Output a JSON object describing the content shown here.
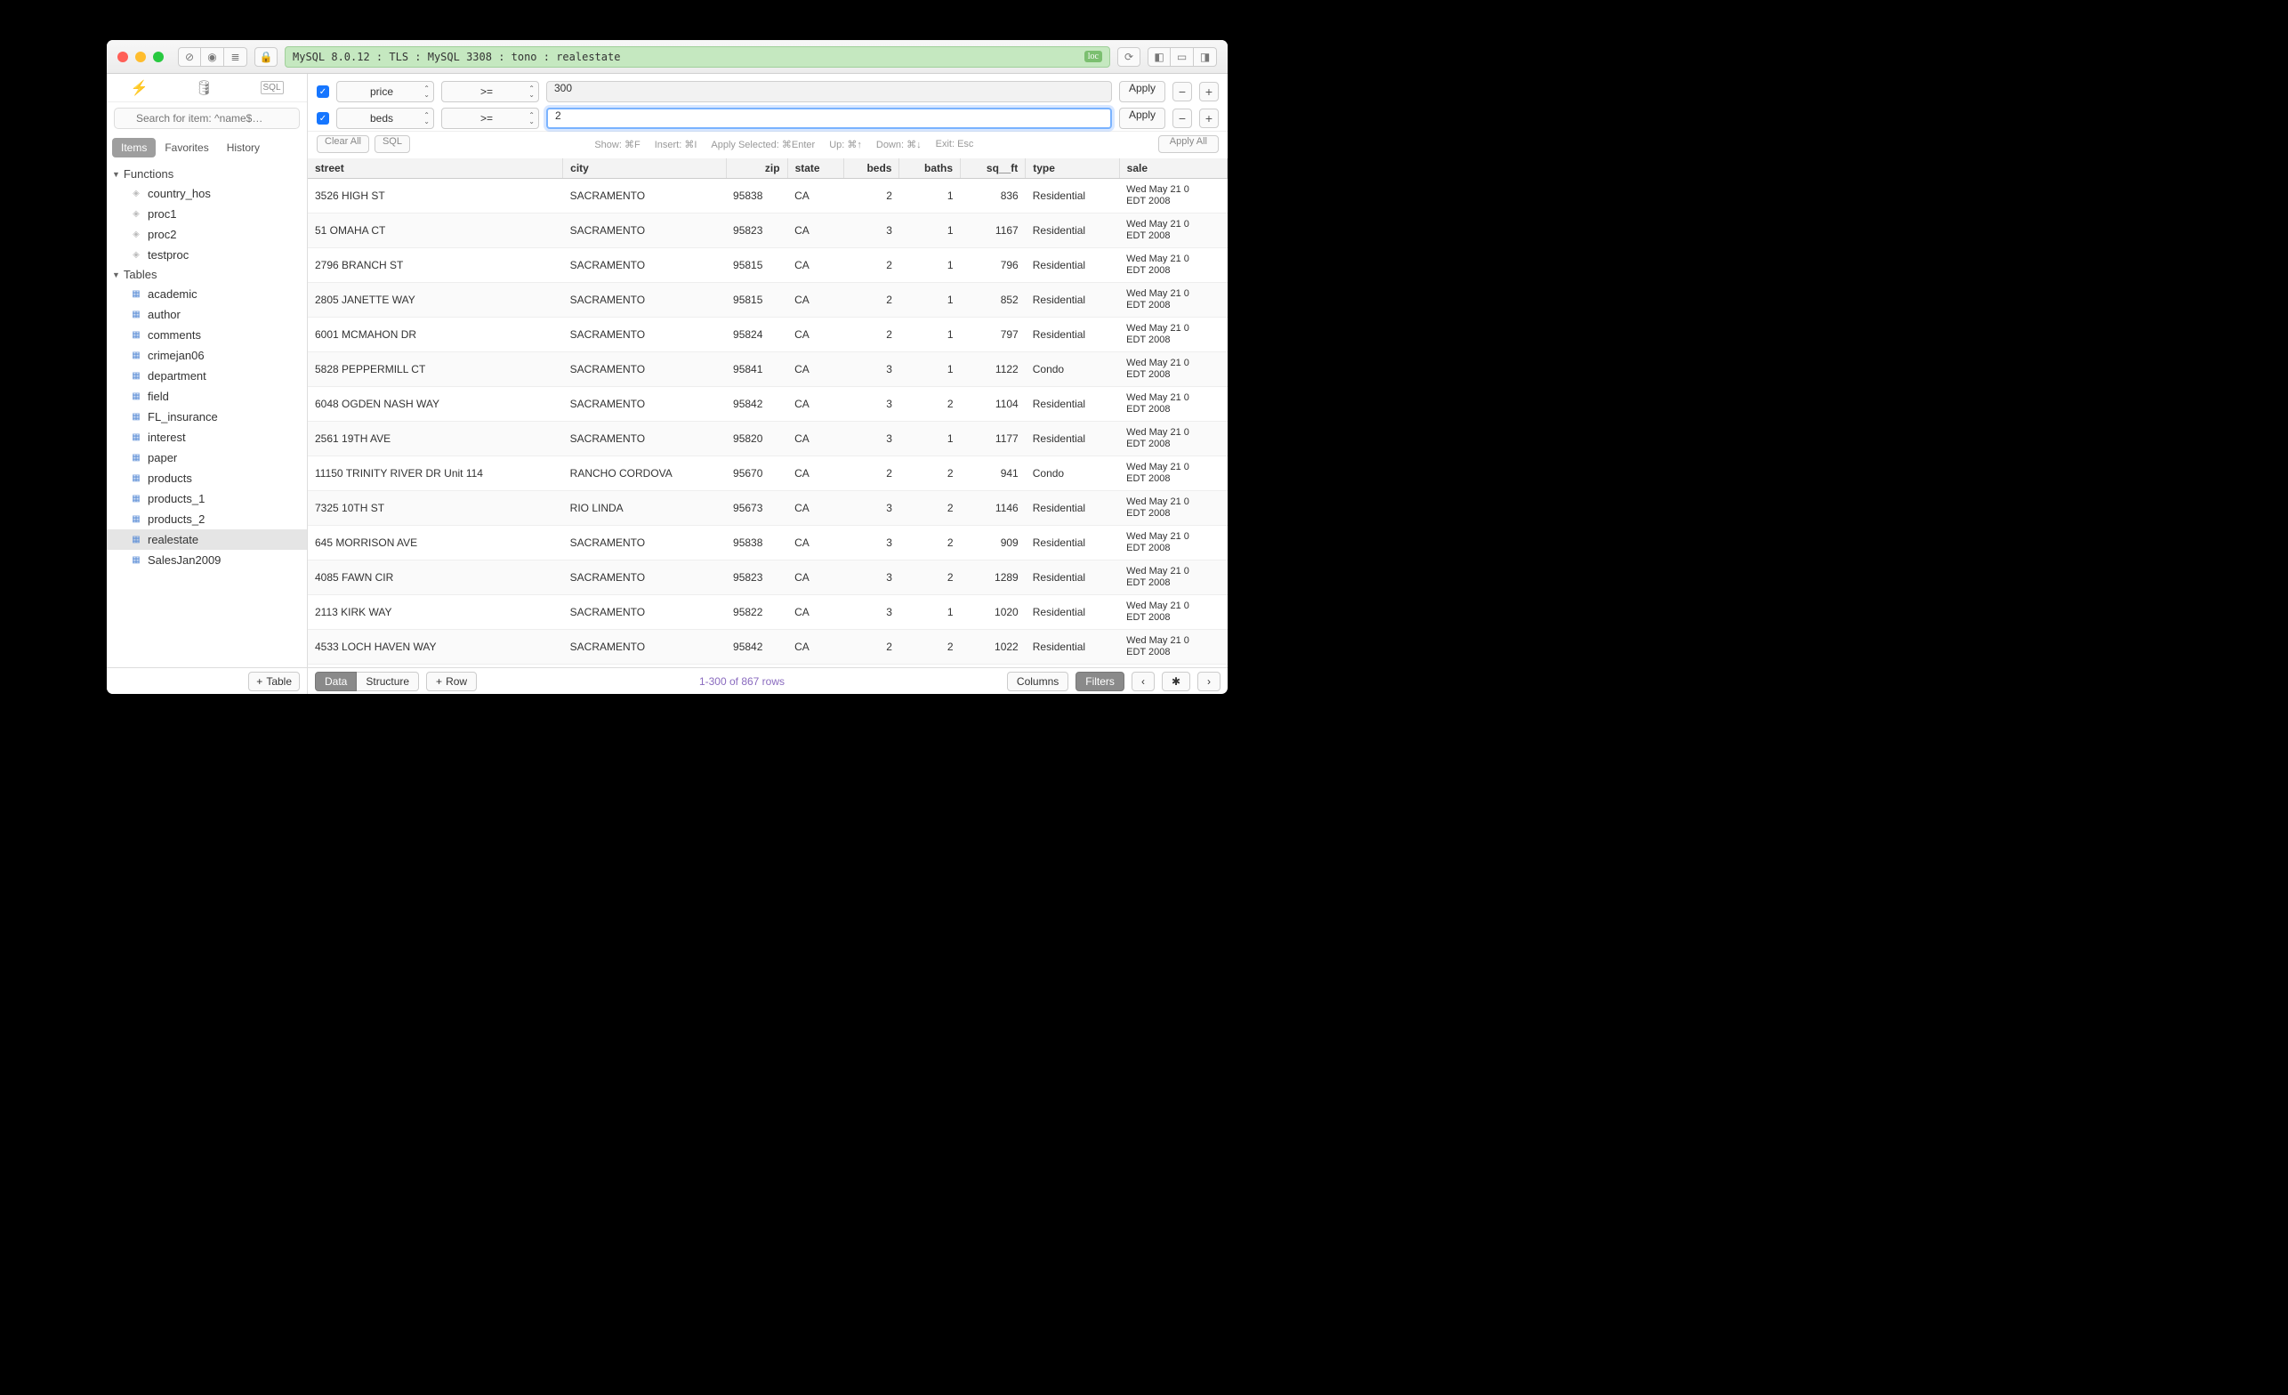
{
  "connection": "MySQL 8.0.12  :  TLS  :  MySQL 3308  :  tono  :  realestate",
  "loc_badge": "loc",
  "sidebar": {
    "search_placeholder": "Search for item: ^name$…",
    "segs": [
      "Items",
      "Favorites",
      "History"
    ],
    "functions_label": "Functions",
    "functions": [
      "country_hos",
      "proc1",
      "proc2",
      "testproc"
    ],
    "tables_label": "Tables",
    "tables": [
      "academic",
      "author",
      "comments",
      "crimejan06",
      "department",
      "field",
      "FL_insurance",
      "interest",
      "paper",
      "products",
      "products_1",
      "products_2",
      "realestate",
      "SalesJan2009"
    ],
    "selected_table": "realestate",
    "add_table": "Table"
  },
  "filters": [
    {
      "enabled": true,
      "column": "price",
      "op": ">=",
      "value": "300",
      "active": false
    },
    {
      "enabled": true,
      "column": "beds",
      "op": ">=",
      "value": "2",
      "active": true
    }
  ],
  "filter_buttons": {
    "apply": "Apply",
    "clear_all": "Clear All",
    "sql": "SQL",
    "apply_all": "Apply All"
  },
  "hints": {
    "show": "Show: ⌘F",
    "insert": "Insert: ⌘I",
    "apply_sel": "Apply Selected: ⌘Enter",
    "up": "Up: ⌘↑",
    "down": "Down: ⌘↓",
    "exit": "Exit: Esc"
  },
  "columns": [
    "street",
    "city",
    "zip",
    "state",
    "beds",
    "baths",
    "sq__ft",
    "type",
    "sale"
  ],
  "rows": [
    {
      "street": "3526 HIGH ST",
      "city": "SACRAMENTO",
      "zip": "95838",
      "state": "CA",
      "beds": 2,
      "baths": 1,
      "sqft": 836,
      "type": "Residential",
      "sale": "Wed May 21 0\nEDT 2008"
    },
    {
      "street": "51 OMAHA CT",
      "city": "SACRAMENTO",
      "zip": "95823",
      "state": "CA",
      "beds": 3,
      "baths": 1,
      "sqft": 1167,
      "type": "Residential",
      "sale": "Wed May 21 0\nEDT 2008"
    },
    {
      "street": "2796 BRANCH ST",
      "city": "SACRAMENTO",
      "zip": "95815",
      "state": "CA",
      "beds": 2,
      "baths": 1,
      "sqft": 796,
      "type": "Residential",
      "sale": "Wed May 21 0\nEDT 2008"
    },
    {
      "street": "2805 JANETTE WAY",
      "city": "SACRAMENTO",
      "zip": "95815",
      "state": "CA",
      "beds": 2,
      "baths": 1,
      "sqft": 852,
      "type": "Residential",
      "sale": "Wed May 21 0\nEDT 2008"
    },
    {
      "street": "6001 MCMAHON DR",
      "city": "SACRAMENTO",
      "zip": "95824",
      "state": "CA",
      "beds": 2,
      "baths": 1,
      "sqft": 797,
      "type": "Residential",
      "sale": "Wed May 21 0\nEDT 2008"
    },
    {
      "street": "5828 PEPPERMILL CT",
      "city": "SACRAMENTO",
      "zip": "95841",
      "state": "CA",
      "beds": 3,
      "baths": 1,
      "sqft": 1122,
      "type": "Condo",
      "sale": "Wed May 21 0\nEDT 2008"
    },
    {
      "street": "6048 OGDEN NASH WAY",
      "city": "SACRAMENTO",
      "zip": "95842",
      "state": "CA",
      "beds": 3,
      "baths": 2,
      "sqft": 1104,
      "type": "Residential",
      "sale": "Wed May 21 0\nEDT 2008"
    },
    {
      "street": "2561 19TH AVE",
      "city": "SACRAMENTO",
      "zip": "95820",
      "state": "CA",
      "beds": 3,
      "baths": 1,
      "sqft": 1177,
      "type": "Residential",
      "sale": "Wed May 21 0\nEDT 2008"
    },
    {
      "street": "11150 TRINITY RIVER DR Unit 114",
      "city": "RANCHO CORDOVA",
      "zip": "95670",
      "state": "CA",
      "beds": 2,
      "baths": 2,
      "sqft": 941,
      "type": "Condo",
      "sale": "Wed May 21 0\nEDT 2008"
    },
    {
      "street": "7325 10TH ST",
      "city": "RIO LINDA",
      "zip": "95673",
      "state": "CA",
      "beds": 3,
      "baths": 2,
      "sqft": 1146,
      "type": "Residential",
      "sale": "Wed May 21 0\nEDT 2008"
    },
    {
      "street": "645 MORRISON AVE",
      "city": "SACRAMENTO",
      "zip": "95838",
      "state": "CA",
      "beds": 3,
      "baths": 2,
      "sqft": 909,
      "type": "Residential",
      "sale": "Wed May 21 0\nEDT 2008"
    },
    {
      "street": "4085 FAWN CIR",
      "city": "SACRAMENTO",
      "zip": "95823",
      "state": "CA",
      "beds": 3,
      "baths": 2,
      "sqft": 1289,
      "type": "Residential",
      "sale": "Wed May 21 0\nEDT 2008"
    },
    {
      "street": "2113 KIRK WAY",
      "city": "SACRAMENTO",
      "zip": "95822",
      "state": "CA",
      "beds": 3,
      "baths": 1,
      "sqft": 1020,
      "type": "Residential",
      "sale": "Wed May 21 0\nEDT 2008"
    },
    {
      "street": "4533 LOCH HAVEN WAY",
      "city": "SACRAMENTO",
      "zip": "95842",
      "state": "CA",
      "beds": 2,
      "baths": 2,
      "sqft": 1022,
      "type": "Residential",
      "sale": "Wed May 21 0\nEDT 2008"
    }
  ],
  "bottombar": {
    "data": "Data",
    "structure": "Structure",
    "row": "Row",
    "rowcount": "1-300 of 867 rows",
    "columns": "Columns",
    "filters": "Filters"
  }
}
